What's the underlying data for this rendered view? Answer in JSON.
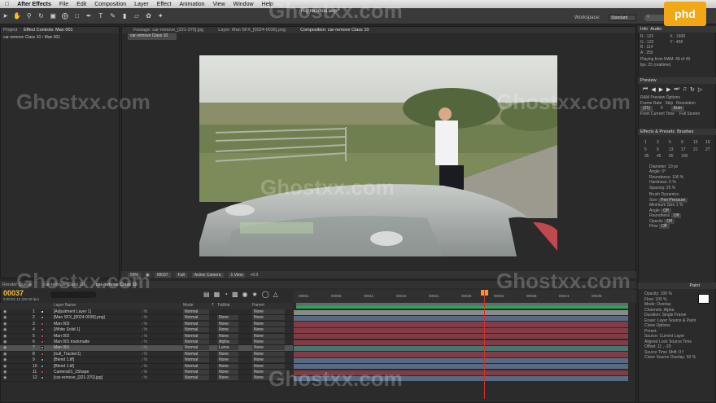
{
  "menubar": {
    "apple": "",
    "app_name": "After Effects",
    "items": [
      "File",
      "Edit",
      "Composition",
      "Layer",
      "Effect",
      "Animation",
      "View",
      "Window",
      "Help"
    ]
  },
  "window_title": "Rig removal.aep *",
  "workspace": {
    "label": "Workspace:",
    "value": "Standard"
  },
  "logo_text": "phd",
  "watermark": "Ghostxx.com",
  "left_panel": {
    "tabs": [
      "Project",
      "Effect Controls: Man 001"
    ],
    "title": "car-remove Class 10 • Man 001"
  },
  "comp_panel": {
    "tabs": [
      "Footage: car-remove_[321-370].jpg",
      "Layer: Man SFX_[0024-0036].png",
      "Composition: car-remove Class 10"
    ],
    "subtab": "car-remove Class 10",
    "footer": {
      "zoom": "50%",
      "timecode": "00037",
      "resolution": "Full",
      "camera": "Active Camera",
      "views": "1 View",
      "exposure": "+0.0"
    }
  },
  "info": {
    "header": "Info",
    "tab2": "Audio",
    "r": "R : 123",
    "g": "G : 122",
    "b": "B : 114",
    "a": "A : 255",
    "x": "X : 1608",
    "y": "Y : 458",
    "playing": "Playing from RAM: 49 of 49",
    "fps": "fps: 25 (realtime)"
  },
  "preview": {
    "header": "Preview",
    "ram_options": "RAM Preview Options",
    "frame_rate": "Frame Rate",
    "skip": "Skip",
    "resolution": "Resolution",
    "fr_val": "(25)",
    "skip_val": "0",
    "res_val": "Auto",
    "from_current": "From Current Time",
    "full_screen": "Full Screen"
  },
  "brushes": {
    "tabs": [
      "Effects & Presets",
      "Brushes"
    ],
    "sizes": [
      "1",
      "3",
      "5",
      "9",
      "13",
      "19",
      "5",
      "9",
      "13",
      "17",
      "21",
      "27",
      "35",
      "45",
      "65",
      "100"
    ],
    "diameter": "Diameter: 10 px",
    "angle": "Angle: 0°",
    "roundness": "Roundness: 100 %",
    "hardness": "Hardness: 0 %",
    "spacing": "Spacing: 25 %",
    "dynamics": "Brush Dynamics",
    "size": "Size",
    "size_val": "Pen Pressure",
    "min_size": "Minimum Size",
    "min_size_val": "1 %",
    "angle2": "Angle",
    "angle2_val": "Off",
    "roundness2": "Roundness",
    "roundness2_val": "Off",
    "opacity": "Opacity",
    "opacity_val": "Off",
    "flow": "Flow",
    "flow_val": "Off"
  },
  "paint": {
    "tabs": [
      "Paint"
    ],
    "opacity": "Opacity: 100 %",
    "flow": "Flow: 100 %",
    "mode": "Mode: Overlay",
    "channels": "Channels: Alpha",
    "duration": "Duration: Single Frame",
    "erase": "Erase: Layer Source & Paint",
    "clone_options": "Clone Options",
    "preset": "Preset:",
    "source": "Source: Current Layer",
    "aligned": "Aligned",
    "lock_source": "Lock Source Time",
    "offset": "Offset: 11 , -20",
    "source_time_shift": "Source Time Shift: 0 f",
    "clone_overlay": "Clone Source Overlay: 50 %"
  },
  "timeline": {
    "tabs": [
      "Render Queue",
      "car-remove Class 10",
      "car-remove Class 10"
    ],
    "time": "00037",
    "subtime": "0:00:01:12 (25.00 fps)",
    "search_placeholder": "",
    "headers": {
      "layer_name": "Layer Name",
      "mode": "Mode",
      "t": "T",
      "trkmat": "TrkMat",
      "parent": "Parent"
    },
    "ruler": [
      "00001",
      "00006",
      "00011",
      "00016",
      "00021",
      "00026",
      "00031",
      "00036",
      "00041",
      "00046"
    ],
    "layers": [
      {
        "num": "1",
        "name": "[Adjustment Layer 1]",
        "color": "#d8d8d8",
        "mode": "Normal",
        "trkmat": "",
        "parent": "None"
      },
      {
        "num": "2",
        "name": "[Man SFX_[0024-0036].png]",
        "color": "#7d9fc8",
        "mode": "Normal",
        "trkmat": "None",
        "parent": "None"
      },
      {
        "num": "3",
        "name": "Man 003",
        "color": "#c94a5c",
        "mode": "Normal",
        "trkmat": "None",
        "parent": "None"
      },
      {
        "num": "4",
        "name": "[White Solid 1]",
        "color": "#c94a5c",
        "mode": "Normal",
        "trkmat": "None",
        "parent": "None"
      },
      {
        "num": "5",
        "name": "Man 002",
        "color": "#c94a5c",
        "mode": "Normal",
        "trkmat": "None",
        "parent": "None"
      },
      {
        "num": "6",
        "name": "Man 001 trackmatte",
        "color": "#c94a5c",
        "mode": "Normal",
        "trkmat": "Alpha",
        "parent": "None"
      },
      {
        "num": "7",
        "name": "Man 001",
        "color": "#5eb3a8",
        "mode": "Normal",
        "trkmat": "Luma",
        "parent": "None"
      },
      {
        "num": "8",
        "name": "[null_Tracker1]",
        "color": "#c94a5c",
        "mode": "Normal",
        "trkmat": "None",
        "parent": "None"
      },
      {
        "num": "9",
        "name": "[Blend 1.tif]",
        "color": "#7d9fc8",
        "mode": "Normal",
        "trkmat": "None",
        "parent": "None"
      },
      {
        "num": "10",
        "name": "[Blend 1.tif]",
        "color": "#7d9fc8",
        "mode": "Normal",
        "trkmat": "None",
        "parent": "None"
      },
      {
        "num": "11",
        "name": "Camera01_2Shape",
        "color": "#c94a5c",
        "mode": "Normal",
        "trkmat": "None",
        "parent": "None"
      },
      {
        "num": "12",
        "name": "[car-remove_[321-370].jpg]",
        "color": "#7d9fc8",
        "mode": "Normal",
        "trkmat": "None",
        "parent": "None"
      }
    ]
  }
}
